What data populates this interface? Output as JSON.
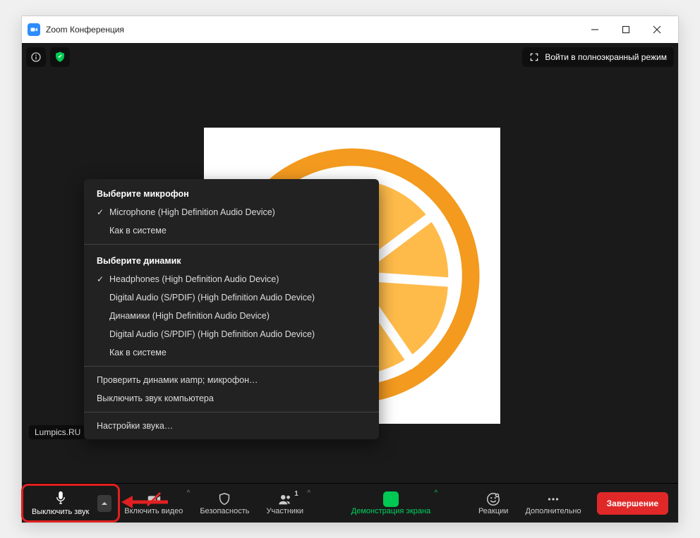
{
  "window": {
    "title": "Zoom Конференция"
  },
  "top": {
    "fullscreen": "Войти в полноэкранный режим"
  },
  "username": "Lumpics.RU",
  "audio_menu": {
    "mic_header": "Выберите микрофон",
    "mic_items": [
      {
        "label": "Microphone (High Definition Audio Device)",
        "checked": true
      },
      {
        "label": "Как в системе",
        "checked": false
      }
    ],
    "speaker_header": "Выберите динамик",
    "speaker_items": [
      {
        "label": "Headphones (High Definition Audio Device)",
        "checked": true
      },
      {
        "label": "Digital Audio (S/PDIF) (High Definition Audio Device)",
        "checked": false
      },
      {
        "label": "Динамики (High Definition Audio Device)",
        "checked": false
      },
      {
        "label": "Digital Audio (S/PDIF) (High Definition Audio Device)",
        "checked": false
      },
      {
        "label": "Как в системе",
        "checked": false
      }
    ],
    "extra": [
      "Проверить динамик иamp; микрофон…",
      "Выключить звук компьютера"
    ],
    "settings": "Настройки звука…"
  },
  "toolbar": {
    "mute": "Выключить звук",
    "video": "Включить видео",
    "security": "Безопасность",
    "participants": "Участники",
    "participants_count": "1",
    "share": "Демонстрация экрана",
    "reactions": "Реакции",
    "more": "Дополнительно",
    "end": "Завершение"
  }
}
